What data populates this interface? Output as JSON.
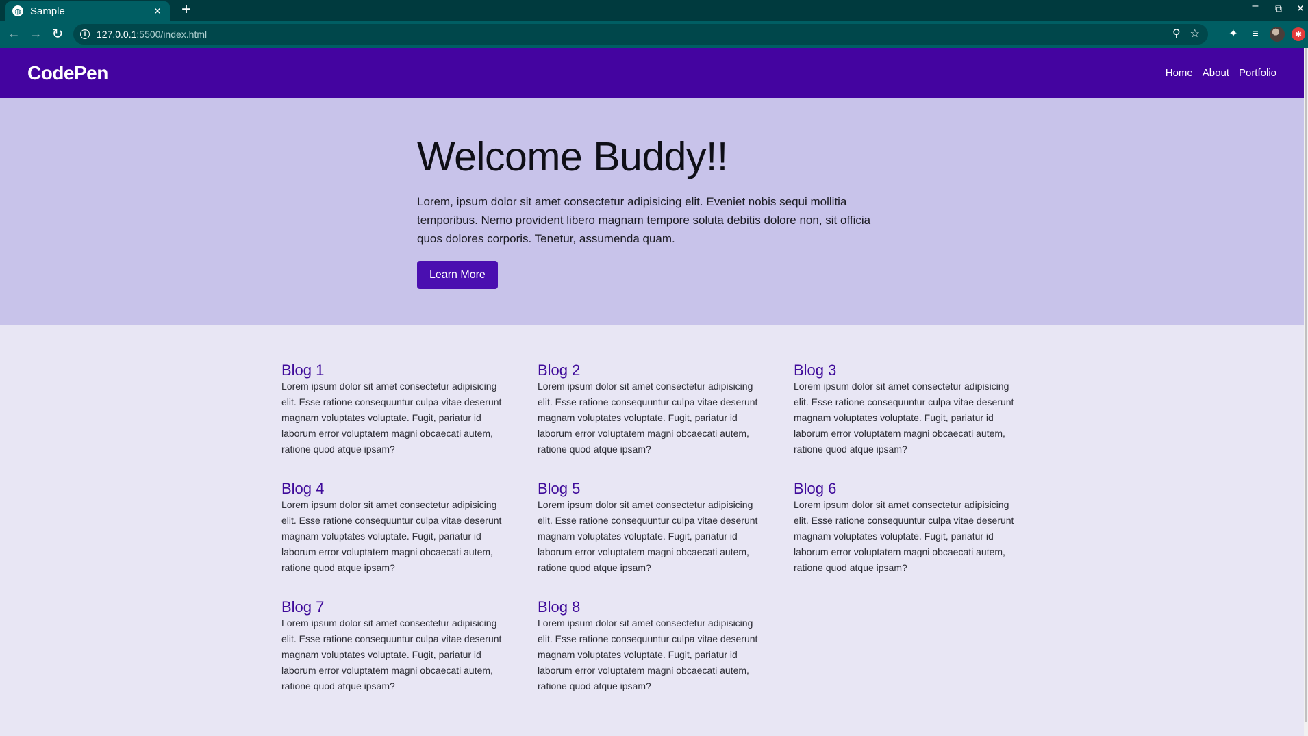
{
  "browser": {
    "tab_title": "Sample",
    "new_tab_symbol": "+",
    "url_host": "127.0.0.1",
    "url_rest": ":5500/index.html",
    "window": {
      "minimize": "–",
      "restore": "⧉",
      "close": "✕"
    }
  },
  "site": {
    "brand": "CodePen",
    "nav": [
      "Home",
      "About",
      "Portfolio"
    ],
    "hero": {
      "title": "Welcome Buddy!!",
      "text": "Lorem, ipsum dolor sit amet consectetur adipisicing elit. Eveniet nobis sequi mollitia temporibus. Nemo provident libero magnam tempore soluta debitis dolore non, sit officia quos dolores corporis. Tenetur, assumenda quam.",
      "button": "Learn More"
    },
    "blogs": [
      {
        "title": "Blog 1",
        "text": "Lorem ipsum dolor sit amet consectetur adipisicing elit. Esse ratione consequuntur culpa vitae deserunt magnam voluptates voluptate. Fugit, pariatur id laborum error voluptatem magni obcaecati autem, ratione quod atque ipsam?"
      },
      {
        "title": "Blog 2",
        "text": "Lorem ipsum dolor sit amet consectetur adipisicing elit. Esse ratione consequuntur culpa vitae deserunt magnam voluptates voluptate. Fugit, pariatur id laborum error voluptatem magni obcaecati autem, ratione quod atque ipsam?"
      },
      {
        "title": "Blog 3",
        "text": "Lorem ipsum dolor sit amet consectetur adipisicing elit. Esse ratione consequuntur culpa vitae deserunt magnam voluptates voluptate. Fugit, pariatur id laborum error voluptatem magni obcaecati autem, ratione quod atque ipsam?"
      },
      {
        "title": "Blog 4",
        "text": "Lorem ipsum dolor sit amet consectetur adipisicing elit. Esse ratione consequuntur culpa vitae deserunt magnam voluptates voluptate. Fugit, pariatur id laborum error voluptatem magni obcaecati autem, ratione quod atque ipsam?"
      },
      {
        "title": "Blog 5",
        "text": "Lorem ipsum dolor sit amet consectetur adipisicing elit. Esse ratione consequuntur culpa vitae deserunt magnam voluptates voluptate. Fugit, pariatur id laborum error voluptatem magni obcaecati autem, ratione quod atque ipsam?"
      },
      {
        "title": "Blog 6",
        "text": "Lorem ipsum dolor sit amet consectetur adipisicing elit. Esse ratione consequuntur culpa vitae deserunt magnam voluptates voluptate. Fugit, pariatur id laborum error voluptatem magni obcaecati autem, ratione quod atque ipsam?"
      },
      {
        "title": "Blog 7",
        "text": "Lorem ipsum dolor sit amet consectetur adipisicing elit. Esse ratione consequuntur culpa vitae deserunt magnam voluptates voluptate. Fugit, pariatur id laborum error voluptatem magni obcaecati autem, ratione quod atque ipsam?"
      },
      {
        "title": "Blog 8",
        "text": "Lorem ipsum dolor sit amet consectetur adipisicing elit. Esse ratione consequuntur culpa vitae deserunt magnam voluptates voluptate. Fugit, pariatur id laborum error voluptatem magni obcaecati autem, ratione quod atque ipsam?"
      }
    ]
  },
  "colors": {
    "chrome_tabbar": "#003a3e",
    "chrome_toolbar": "#005e63",
    "site_nav": "#4404a0",
    "hero_bg": "#c8c3ea",
    "page_bg": "#e8e6f4",
    "button": "#4a0fb0",
    "blog_title": "#3f0b9a"
  },
  "icons": {
    "tab": "globe-icon",
    "toolbar": [
      "back-arrow-icon",
      "forward-arrow-icon",
      "reload-icon",
      "info-icon",
      "zoom-icon",
      "star-icon",
      "extensions-icon",
      "media-icon",
      "profile-avatar",
      "update-icon"
    ]
  }
}
